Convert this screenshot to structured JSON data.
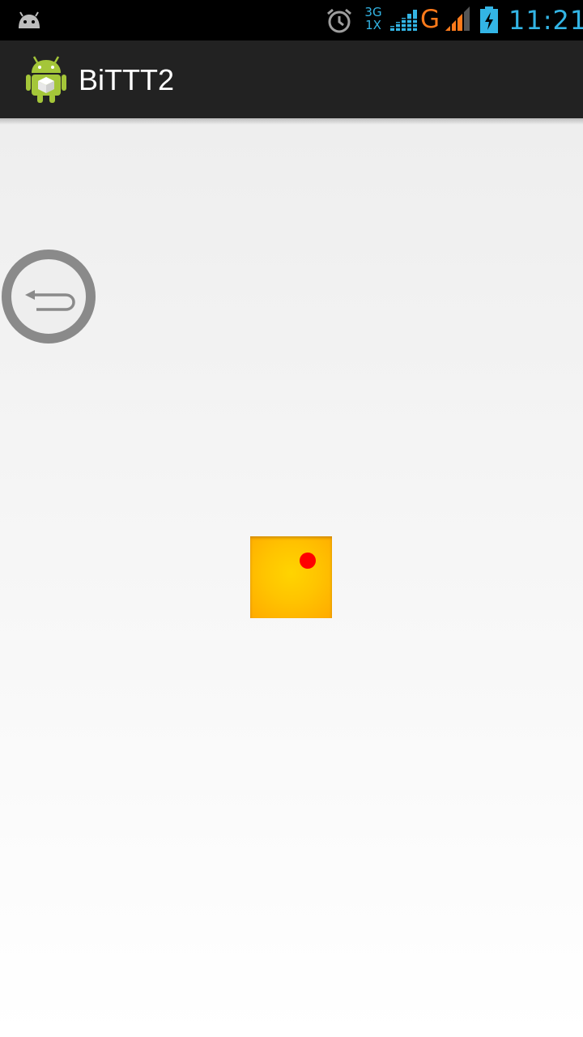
{
  "status_bar": {
    "network_type_top": "3G",
    "network_type_bottom": "1X",
    "data_indicator": "G",
    "time": "11:21",
    "notification_icon": "android-icon",
    "alarm_icon": "alarm-clock-icon",
    "signal_icon": "signal-bars-icon",
    "battery_icon": "battery-charging-icon",
    "colors": {
      "accent": "#33b5e5",
      "data_indicator": "#ff7a1a"
    }
  },
  "action_bar": {
    "title": "BiTTT2",
    "app_icon": "android-robot-icon"
  },
  "content": {
    "back_button_icon": "undo-arrow-icon",
    "square_color": "#ffc400",
    "dot_color": "#ff0000"
  }
}
